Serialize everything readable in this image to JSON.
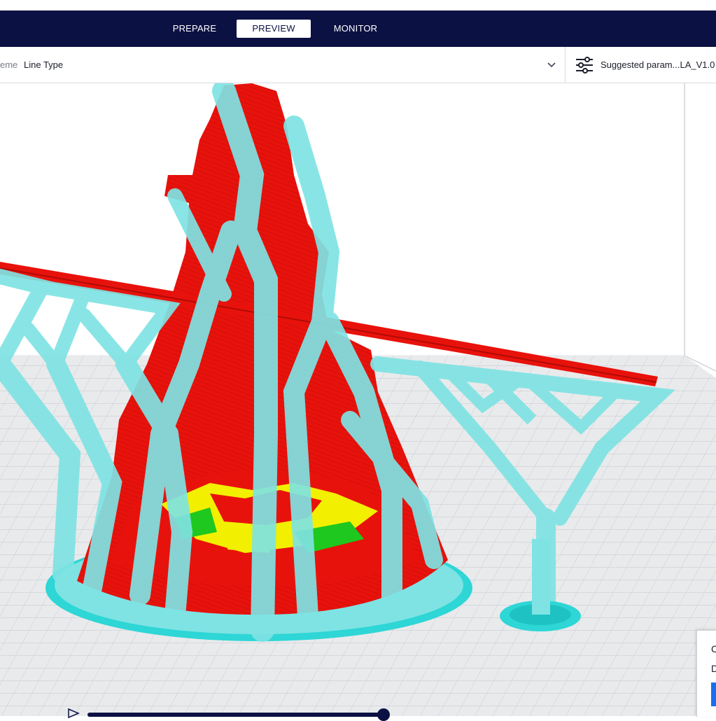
{
  "app": {
    "tabs": [
      {
        "label": "PREPARE",
        "active": false
      },
      {
        "label": "PREVIEW",
        "active": true
      },
      {
        "label": "MONITOR",
        "active": false
      }
    ]
  },
  "toolbar": {
    "scheme_label": "eme",
    "scheme_value": "Line Type",
    "profile_label": "Suggested param...LA_V1.0 -"
  },
  "side_panel": {
    "fragments": [
      "C",
      "D"
    ]
  },
  "colors": {
    "nav_bg": "#0c1143",
    "support": "#7fe3e3",
    "model_wall": "#e8120c",
    "infill": "#f2f000",
    "skin": "#1ec81e",
    "build_plate": "#e9eaec",
    "accent_blue": "#196ef0"
  },
  "icons": [
    "settings-sliders-icon",
    "chevron-down-icon",
    "play-icon"
  ]
}
